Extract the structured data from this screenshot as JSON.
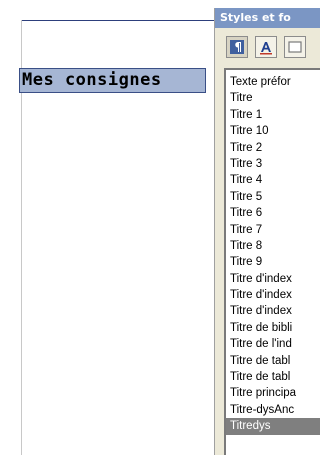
{
  "document": {
    "heading": "Mes consignes"
  },
  "panel": {
    "title": "Styles et fo",
    "toolbar": [
      {
        "icon": "paragraph-styles-icon",
        "active": true
      },
      {
        "icon": "character-styles-icon",
        "active": false
      },
      {
        "icon": "frame-styles-icon",
        "active": false
      }
    ],
    "styles": [
      "Texte préfor",
      "Titre",
      "Titre 1",
      "Titre 10",
      "Titre 2",
      "Titre 3",
      "Titre 4",
      "Titre 5",
      "Titre 6",
      "Titre 7",
      "Titre 8",
      "Titre 9",
      "Titre d'index",
      "Titre d'index",
      "Titre d'index",
      "Titre de bibli",
      "Titre de l'ind",
      "Titre de tabl",
      "Titre de tabl",
      "Titre principa",
      "Titre-dysAnc",
      "Titredys"
    ],
    "selected_index": 21
  },
  "colors": {
    "title_bar": "#7b96c4",
    "heading_bg": "#a6b6d4",
    "selection": "#7f7f7f",
    "panel_bg": "#ece9d8"
  }
}
